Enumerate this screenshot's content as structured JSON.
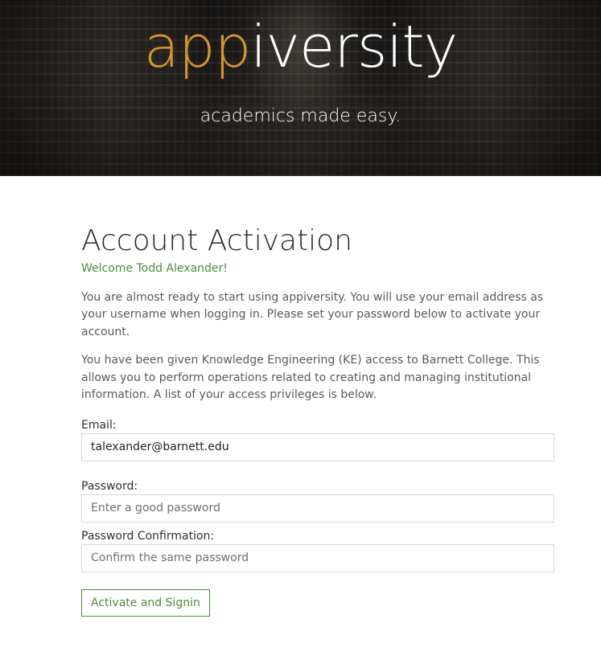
{
  "header": {
    "logo_part1": "app",
    "logo_part2": "iversity",
    "tagline": "academics made easy."
  },
  "page": {
    "title": "Account Activation",
    "welcome": "Welcome Todd Alexander!",
    "paragraph1": "You are almost ready to start using appiversity. You will use your email address as your username when logging in. Please set your password below to activate your account.",
    "paragraph2": "You have been given Knowledge Engineering (KE) access to Barnett College. This allows you to perform operations related to creating and managing institutional information. A list of your access privileges is below."
  },
  "form": {
    "email_label": "Email:",
    "email_value": "talexander@barnett.edu",
    "password_label": "Password:",
    "password_placeholder": "Enter a good password",
    "confirm_label": "Password Confirmation:",
    "confirm_placeholder": "Confirm the same password",
    "submit_label": "Activate and Signin"
  },
  "colors": {
    "brand_orange": "#d4942e",
    "accent_green": "#4e8a3a"
  }
}
